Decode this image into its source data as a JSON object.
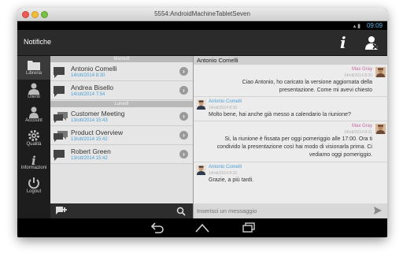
{
  "window": {
    "title": "5554:AndroidMachineTabletSeven"
  },
  "status": {
    "time": "09:09"
  },
  "actionbar": {
    "title": "Notifiche",
    "info_icon": "info-icon",
    "user_icon": "user-remove-icon"
  },
  "nav": {
    "items": [
      {
        "label": "Libreria",
        "icon": "folder-icon"
      },
      {
        "label": "Utenti",
        "icon": "users-icon"
      },
      {
        "label": "Account",
        "icon": "account-icon"
      },
      {
        "label": "Qualità",
        "icon": "gear-icon"
      },
      {
        "label": "Informazioni",
        "icon": "info-icon"
      },
      {
        "label": "Logout",
        "icon": "power-icon"
      }
    ]
  },
  "list": {
    "sections": [
      "Martedì",
      "Lunedì"
    ],
    "items": [
      {
        "name": "Antonio Comelli",
        "date": "14/ott/2014 8:30"
      },
      {
        "name": "Andrea Bisello",
        "date": "14/ott/2014 7:54"
      },
      {
        "name": "Customer Meeting",
        "date": "13/ott/2014 15:43"
      },
      {
        "name": "Product Overview",
        "date": "13/ott/2014 15:42"
      },
      {
        "name": "Robert Green",
        "date": "13/ott/2014 15:42"
      }
    ]
  },
  "chat": {
    "header": "Antonio Comelli",
    "messages": [
      {
        "sender": "Max Gray",
        "date": "14/ott/2014 8:30",
        "text": "Ciao Antonio, ho caricato la versione aggiornata della presentazione. Come mi avevi chiesto",
        "side": "right"
      },
      {
        "sender": "Antonio Comelli",
        "date": "14/ott/2014 8:30",
        "text": "Molto bene, hai anche già messo a calendario la riunione?",
        "side": "left"
      },
      {
        "sender": "Max Gray",
        "date": "14/ott/2014 8:31",
        "text": "Si, la riunione è fissata per oggi pomeriggio alle 17:00. Ora ti condivido la presentazione così hai modo di visionarla prima. Ci vediamo oggi pomeriggio.",
        "side": "right"
      },
      {
        "sender": "Antonio Comelli",
        "date": "14/ott/2014 8:32",
        "text": "Grazie, a più tardi.",
        "side": "left"
      }
    ],
    "input_placeholder": "Inserisci un messaggio"
  }
}
